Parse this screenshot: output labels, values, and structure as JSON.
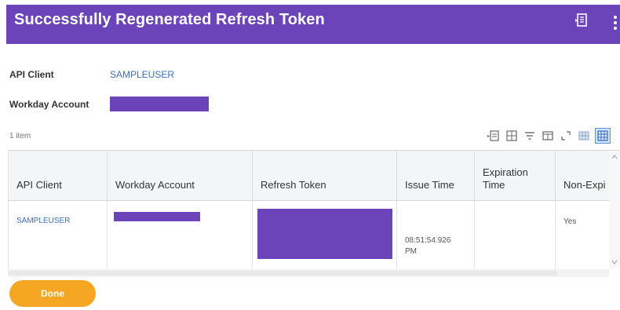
{
  "header": {
    "title": "Successfully Regenerated Refresh Token",
    "background_color": "#6a44b8",
    "icons": [
      "export-to-pdf-icon",
      "kebab-menu-icon"
    ]
  },
  "details": {
    "api_client_label": "API Client",
    "api_client_value": "SAMPLEUSER",
    "workday_account_label": "Workday Account",
    "workday_account_value_redacted": true
  },
  "grid": {
    "item_count": "1 item",
    "toolbar_icons": [
      "export-to-excel-icon",
      "export-to-pdf-icon",
      "filter-icon",
      "column-chooser-icon",
      "fullscreen-icon",
      "grid-view-icon",
      "table-view-icon"
    ],
    "columns": [
      "API Client",
      "Workday Account",
      "Refresh Token",
      "Issue Time",
      "Expiration Time",
      "Non-Expi"
    ],
    "rows": [
      {
        "api_client": "SAMPLEUSER",
        "workday_account_redacted": true,
        "refresh_token_redacted": true,
        "issue_time": "08:51:54.926 PM",
        "expiration_time": "",
        "non_expiring": "Yes"
      }
    ]
  },
  "footer": {
    "done_label": "Done",
    "done_color": "#f5a623"
  },
  "colors": {
    "accent_purple": "#6a44b8",
    "link_blue": "#3a6fc4",
    "done_orange": "#f5a623"
  }
}
